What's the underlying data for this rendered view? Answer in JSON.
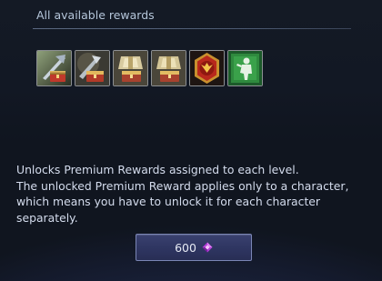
{
  "rewards_section": {
    "title": "All available rewards",
    "items": [
      {
        "icon": "weapon-in-chest-icon"
      },
      {
        "icon": "weapon-crate-icon"
      },
      {
        "icon": "gold-armor-chest-icon"
      },
      {
        "icon": "gold-armor-chest-icon"
      },
      {
        "icon": "red-emblem-icon"
      },
      {
        "icon": "green-figure-icon"
      }
    ]
  },
  "description": {
    "line1": "Unlocks Premium Rewards assigned to each level.",
    "line2": "The unlocked Premium Reward applies only to a character,",
    "line3": "which means you have to unlock it for each character",
    "line4": "separately."
  },
  "purchase": {
    "cost": "600",
    "currency_icon": "purple-gem-icon",
    "colors": {
      "gem": "#c04ce0",
      "button": "#2f3662",
      "border": "#7a85b4"
    }
  }
}
